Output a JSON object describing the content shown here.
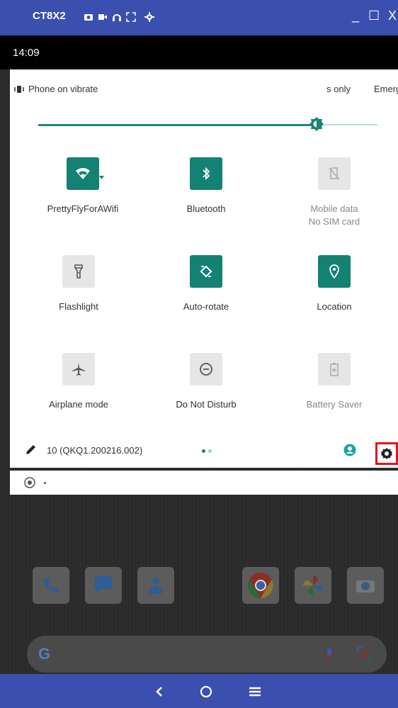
{
  "window": {
    "title": "CT8X2",
    "controls": [
      "_",
      "☐",
      "X"
    ]
  },
  "status_bar": {
    "time": "14:09"
  },
  "quick_settings": {
    "ringer_text": "Phone on vibrate",
    "scrolling_text_1": "s only",
    "scrolling_text_2": "Emerg",
    "brightness_fraction": 0.82,
    "tiles": [
      {
        "label": "PrettyFlyForAWifi",
        "sublabel": "",
        "icon": "wifi-icon",
        "state": "on"
      },
      {
        "label": "Bluetooth",
        "sublabel": "",
        "icon": "bluetooth-icon",
        "state": "on"
      },
      {
        "label": "Mobile data",
        "sublabel": "No SIM card",
        "icon": "no-sim-icon",
        "state": "unavailable"
      },
      {
        "label": "Flashlight",
        "sublabel": "",
        "icon": "flashlight-icon",
        "state": "off"
      },
      {
        "label": "Auto-rotate",
        "sublabel": "",
        "icon": "auto-rotate-icon",
        "state": "on"
      },
      {
        "label": "Location",
        "sublabel": "",
        "icon": "location-icon",
        "state": "on"
      },
      {
        "label": "Airplane mode",
        "sublabel": "",
        "icon": "airplane-icon",
        "state": "off"
      },
      {
        "label": "Do Not Disturb",
        "sublabel": "",
        "icon": "dnd-icon",
        "state": "off"
      },
      {
        "label": "Battery Saver",
        "sublabel": "",
        "icon": "battery-saver-icon",
        "state": "unavailable"
      }
    ],
    "build_number": "10 (QKQ1.200216.002)",
    "page_count": 2,
    "current_page": 1
  },
  "colors": {
    "accent": "#148273",
    "titlebar": "#3a4fae",
    "highlight": "#e01818"
  },
  "dock_apps": [
    "phone-icon",
    "messages-icon",
    "contacts-icon",
    "chrome-icon",
    "photos-icon",
    "camera-icon"
  ],
  "search_bar": {
    "logo": "G"
  }
}
